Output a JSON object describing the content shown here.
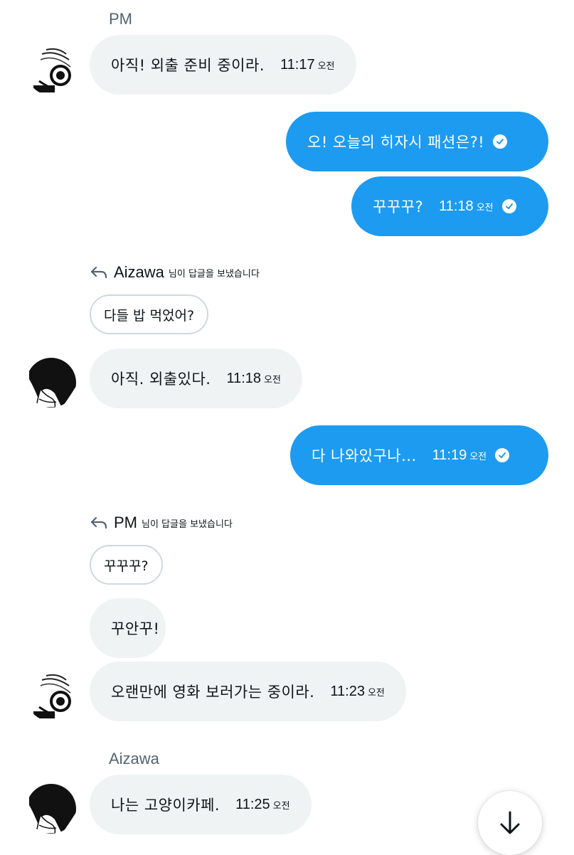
{
  "senders": {
    "pm": "PM",
    "aizawa": "Aizawa"
  },
  "messages": {
    "m1": {
      "text": "아직! 외출 준비 중이라.",
      "time": "11:17",
      "ampm": "오전"
    },
    "m2": {
      "text": "오! 오늘의 히자시 패션은?!"
    },
    "m3": {
      "text": "꾸꾸꾸?",
      "time": "11:18",
      "ampm": "오전"
    },
    "m4": {
      "text": "아직. 외출있다.",
      "time": "11:18",
      "ampm": "오전"
    },
    "m5": {
      "text": "다 나와있구나...",
      "time": "11:19",
      "ampm": "오전"
    },
    "m6": {
      "text": "꾸안꾸!"
    },
    "m7": {
      "text": "오랜만에 영화 보러가는 중이라.",
      "time": "11:23",
      "ampm": "오전"
    },
    "m8": {
      "text": "나는 고양이카페.",
      "time": "11:25",
      "ampm": "오전"
    }
  },
  "replies": {
    "r1": {
      "name": "Aizawa",
      "suffix": "님이 답글을 보냈습니다",
      "quote": "다들 밥 먹었어?"
    },
    "r2": {
      "name": "PM",
      "suffix": "님이 답글을 보냈습니다",
      "quote": "꾸꾸꾸?"
    }
  },
  "icons": {
    "reply": "reply-arrow-icon",
    "read": "read-check-icon",
    "scroll": "arrow-down-icon"
  },
  "colors": {
    "outgoing": "#1d9bf0",
    "incoming": "#eff3f4",
    "meta": "#536471"
  }
}
